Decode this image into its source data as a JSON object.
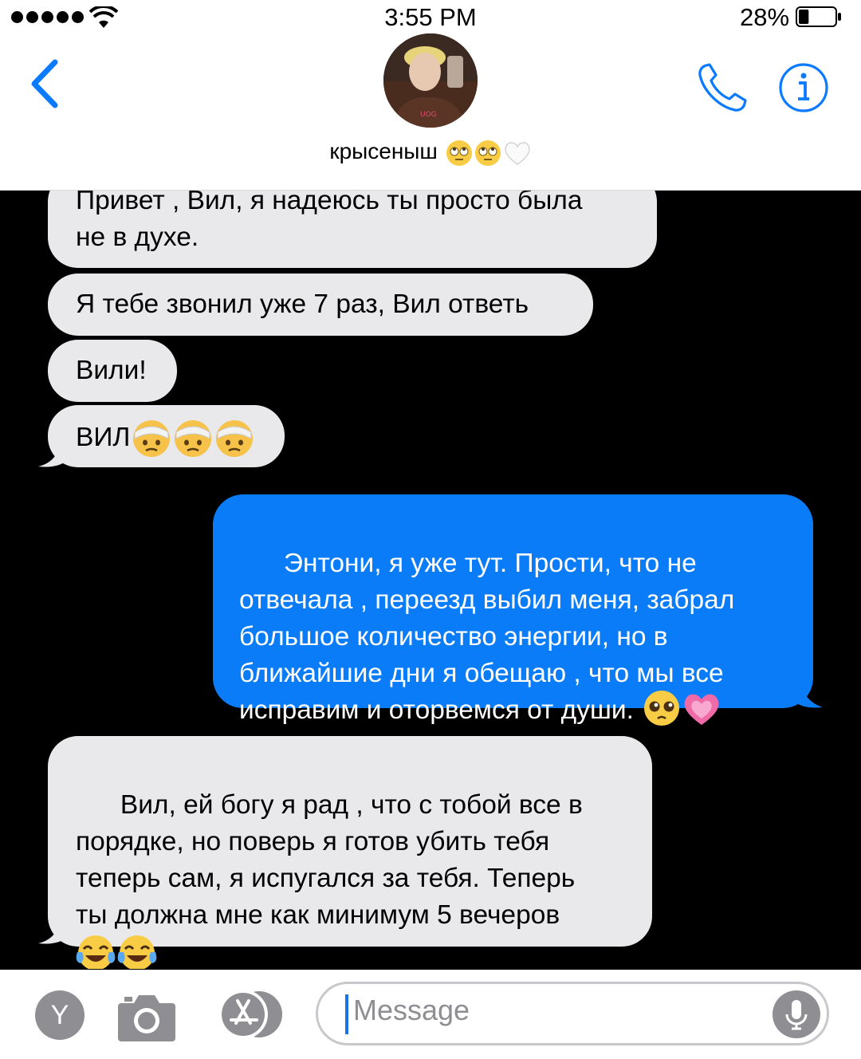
{
  "status_bar": {
    "time": "3:55 PM",
    "battery_percent": "28%",
    "battery_level": 0.28
  },
  "header": {
    "contact_name": "крысеныш",
    "contact_emojis": [
      "eye-roll-emoji",
      "eye-roll-emoji",
      "white-heart-emoji"
    ],
    "back_icon": "chevron-left-icon",
    "call_icon": "phone-icon",
    "info_icon": "info-icon"
  },
  "messages": [
    {
      "side": "received",
      "text": "Привет , Вил, я надеюсь ты просто была\nне в духе.",
      "emojis": []
    },
    {
      "side": "received",
      "text": "Я тебе звонил уже 7 раз, Вил ответь",
      "emojis": []
    },
    {
      "side": "received",
      "text": "Вили!",
      "emojis": []
    },
    {
      "side": "received",
      "text": "ВИЛ",
      "emojis": [
        "bandaged-face-emoji",
        "bandaged-face-emoji",
        "bandaged-face-emoji"
      ]
    },
    {
      "side": "sent",
      "text": "Энтони, я уже тут. Прости, что не\nотвечала , переезд выбил меня, забрал\nбольшое количество энергии, но в\nближайшие дни я обещаю , что мы все\nисправим и оторвемся от души. ",
      "emojis": [
        "pleading-face-emoji",
        "growing-heart-emoji"
      ]
    },
    {
      "side": "received",
      "text": "Вил, ей богу я рад , что с тобой все в\nпорядке, но поверь я готов убить тебя\nтеперь сам, я испугался за тебя. Теперь\nты должна мне как минимум 5 вечеров\n",
      "emojis": [
        "tears-of-joy-emoji",
        "tears-of-joy-emoji"
      ]
    }
  ],
  "input_bar": {
    "placeholder": "Message",
    "left_avatar_letter": "Y",
    "camera_icon": "camera-icon",
    "apps_icon": "app-store-icon",
    "mic_icon": "microphone-icon"
  },
  "colors": {
    "sent_bubble": "#0b7cf8",
    "received_bubble": "#e9e9eb",
    "accent": "#0a7aff",
    "thread_background": "#000000"
  }
}
